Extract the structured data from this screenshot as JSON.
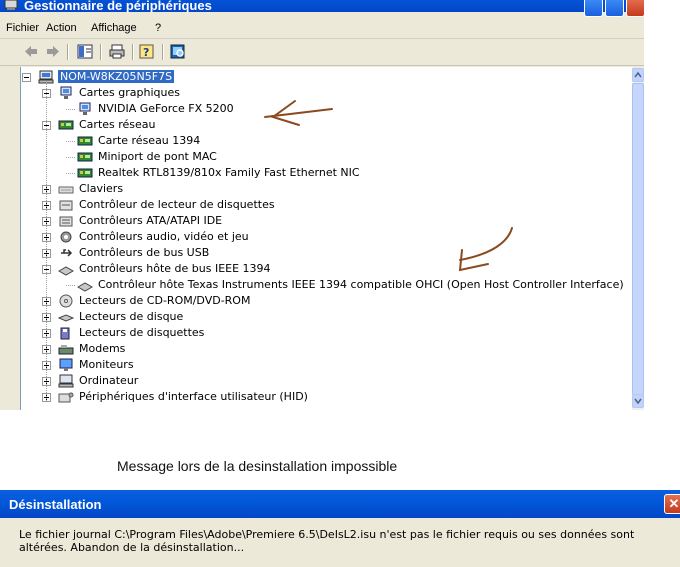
{
  "window": {
    "title": "Gestionnaire de périphériques"
  },
  "menu": [
    "Fichier",
    "Action",
    "Affichage",
    "?"
  ],
  "toolbar": {
    "icons": [
      "back-arrow-icon",
      "forward-arrow-icon",
      "properties-icon",
      "print-icon",
      "help-icon",
      "scan-hardware-icon"
    ]
  },
  "tree": {
    "root": "NOM-W8KZ05N5F7S",
    "items": [
      {
        "label": "Cartes graphiques",
        "level": 1,
        "state": "expanded",
        "icon": "display-adapter-icon"
      },
      {
        "label": "NVIDIA GeForce FX 5200",
        "level": 2,
        "icon": "display-adapter-icon"
      },
      {
        "label": "Cartes réseau",
        "level": 1,
        "state": "expanded",
        "icon": "network-card-icon"
      },
      {
        "label": "Carte réseau 1394",
        "level": 2,
        "icon": "network-card-icon"
      },
      {
        "label": "Miniport de pont MAC",
        "level": 2,
        "icon": "network-card-icon"
      },
      {
        "label": "Realtek RTL8139/810x Family Fast Ethernet NIC",
        "level": 2,
        "icon": "network-card-icon"
      },
      {
        "label": "Claviers",
        "level": 1,
        "state": "collapsed",
        "icon": "keyboard-icon"
      },
      {
        "label": "Contrôleur de lecteur de disquettes",
        "level": 1,
        "state": "collapsed",
        "icon": "floppy-controller-icon"
      },
      {
        "label": "Contrôleurs ATA/ATAPI IDE",
        "level": 1,
        "state": "collapsed",
        "icon": "ide-controller-icon"
      },
      {
        "label": "Contrôleurs audio, vidéo et jeu",
        "level": 1,
        "state": "collapsed",
        "icon": "audio-icon"
      },
      {
        "label": "Contrôleurs de bus USB",
        "level": 1,
        "state": "collapsed",
        "icon": "usb-icon"
      },
      {
        "label": "Contrôleurs hôte de bus IEEE 1394",
        "level": 1,
        "state": "expanded",
        "icon": "firewire-controller-icon"
      },
      {
        "label": "Contrôleur hôte Texas Instruments IEEE 1394 compatible OHCI (Open Host Controller Interface)",
        "level": 2,
        "icon": "firewire-controller-icon"
      },
      {
        "label": "Lecteurs de CD-ROM/DVD-ROM",
        "level": 1,
        "state": "collapsed",
        "icon": "cdrom-icon"
      },
      {
        "label": "Lecteurs de disque",
        "level": 1,
        "state": "collapsed",
        "icon": "disk-drive-icon"
      },
      {
        "label": "Lecteurs de disquettes",
        "level": 1,
        "state": "collapsed",
        "icon": "floppy-drive-icon"
      },
      {
        "label": "Modems",
        "level": 1,
        "state": "collapsed",
        "icon": "modem-icon"
      },
      {
        "label": "Moniteurs",
        "level": 1,
        "state": "collapsed",
        "icon": "monitor-icon"
      },
      {
        "label": "Ordinateur",
        "level": 1,
        "state": "collapsed",
        "icon": "computer-icon"
      },
      {
        "label": "Périphériques d'interface utilisateur (HID)",
        "level": 1,
        "state": "collapsed",
        "icon": "hid-icon"
      }
    ]
  },
  "caption": "Message  lors de la desinstallation impossible",
  "dialog": {
    "title": "Désinstallation",
    "message": "Le fichier journal C:\\Program Files\\Adobe\\Premiere 6.5\\DeIsL2.isu n'est pas le fichier requis ou ses données sont altérées. Abandon de la désinstallation..."
  },
  "colors": {
    "titlebar": "#0454d8",
    "selection": "#316ac5",
    "annotation": "#8b4a1e",
    "window_bg": "#ece9d8"
  }
}
